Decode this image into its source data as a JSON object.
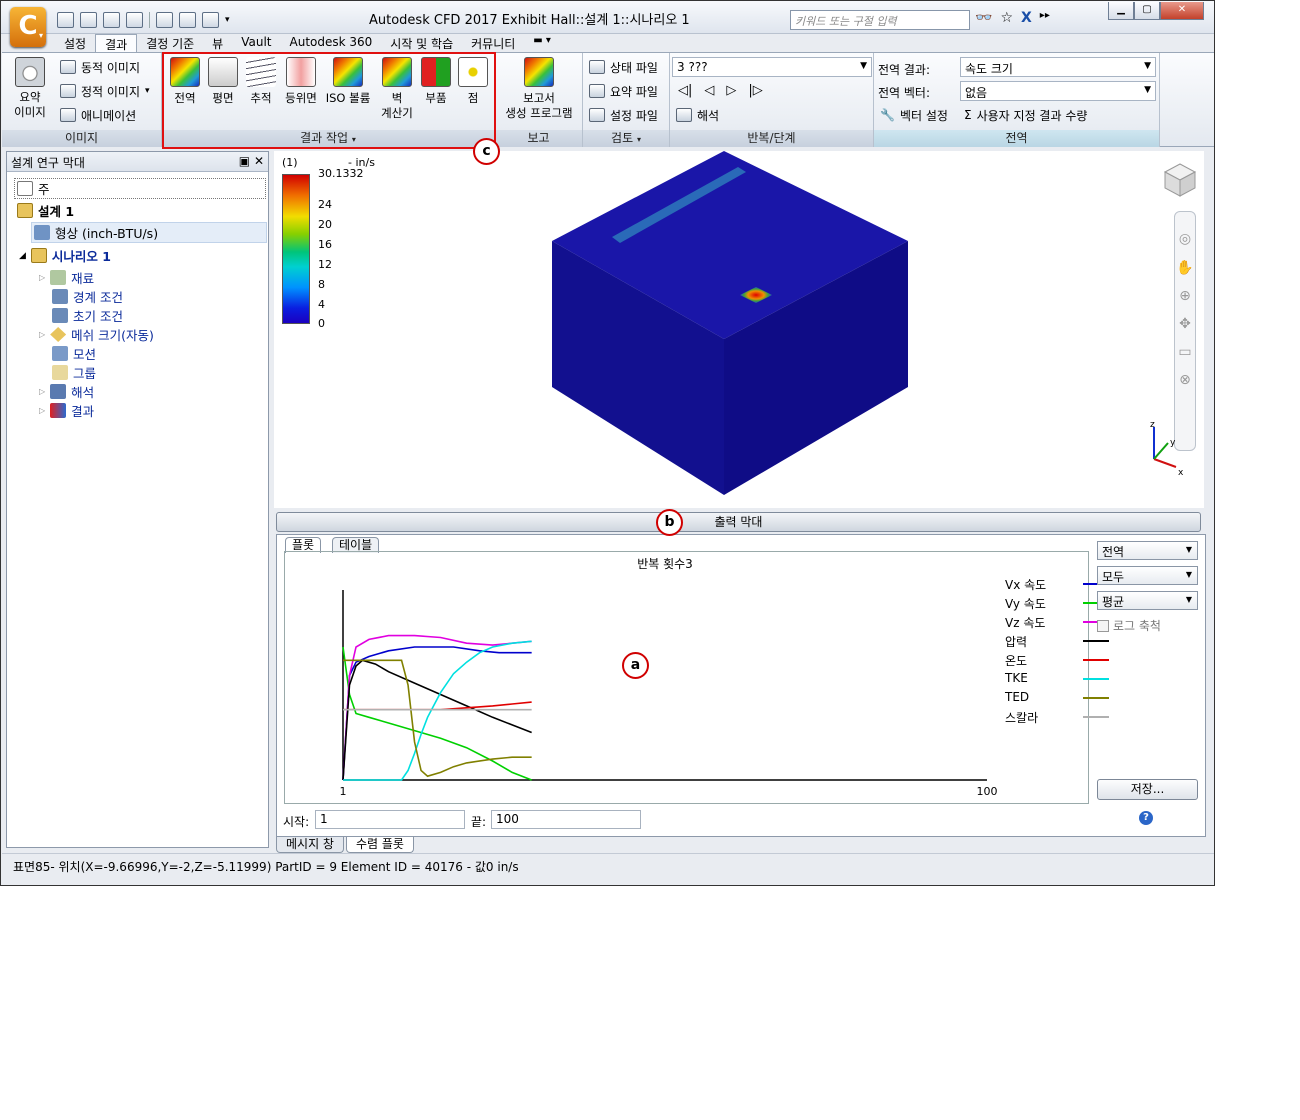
{
  "window": {
    "title": "Autodesk CFD 2017    Exhibit Hall::설계 1::시나리오 1",
    "search_placeholder": "키워드 또는 구절 입력",
    "app_letter": "C"
  },
  "menu_tabs": [
    "설정",
    "결과",
    "결정 기준",
    "뷰",
    "Vault",
    "Autodesk 360",
    "시작 및 학습",
    "커뮤니티"
  ],
  "ribbon": {
    "image_group": {
      "label": "이미지",
      "summary_image": "요약\n이미지",
      "summary_image_line1": "요약",
      "summary_image_line2": "이미지",
      "dynamic_image": "동적 이미지",
      "static_image": "정적 이미지",
      "animation": "애니메이션"
    },
    "results_group": {
      "label": "결과 작업",
      "buttons": [
        "전역",
        "평면",
        "추적",
        "등위면",
        "ISO 볼륨",
        "벽",
        "부품",
        "점"
      ],
      "wall_second_line": "계산기"
    },
    "report_group": {
      "label": "보고",
      "line1": "보고서",
      "line2": "생성 프로그램"
    },
    "review_group": {
      "label": "검토",
      "status_file": "상태 파일",
      "summary_file": "요약 파일",
      "setup_file": "설정 파일"
    },
    "iteration_group": {
      "label": "반복/단계",
      "selector": "3 ???",
      "analysis": "해석"
    },
    "global_group": {
      "label": "전역",
      "global_result_label": "전역 결과:",
      "global_result_value": "속도 크기",
      "global_vector_label": "전역 벡터:",
      "global_vector_value": "없음",
      "vector_settings": "벡터 설정",
      "custom_quantity": "사용자 지정 결과 수량"
    }
  },
  "callouts": {
    "a": "a",
    "b": "b",
    "c": "c"
  },
  "design_panel": {
    "title": "설계 연구 막대",
    "items": [
      {
        "label": "주"
      },
      {
        "label": "설계 1"
      },
      {
        "label": "형상 (inch-BTU/s)"
      },
      {
        "label": "시나리오 1"
      },
      {
        "label": "재료"
      },
      {
        "label": "경계 조건"
      },
      {
        "label": "초기 조건"
      },
      {
        "label": "메쉬 크기(자동)"
      },
      {
        "label": "모션"
      },
      {
        "label": "그룹"
      },
      {
        "label": "해석"
      },
      {
        "label": "결과"
      }
    ]
  },
  "viewport": {
    "legend_header": "(1)",
    "legend_unit": "- in/s",
    "legend_max": "30.1332",
    "legend_ticks": [
      "24",
      "20",
      "16",
      "12",
      "8",
      "4",
      "0"
    ],
    "axis_labels": {
      "z": "z",
      "y": "y",
      "x": "x"
    }
  },
  "output_bar": {
    "title": "출력 막대"
  },
  "output_tabs": {
    "plot": "플롯",
    "table": "테이블"
  },
  "chart_data": {
    "type": "line",
    "title": "반복 횟수3",
    "x_range": [
      1,
      100
    ],
    "tick_labels": [
      "1",
      "100"
    ],
    "x_plotted_until": 30,
    "series": [
      {
        "name": "Vx 속도",
        "color": "#0000cc",
        "values": [
          [
            1,
            0.0
          ],
          [
            2,
            0.55
          ],
          [
            3,
            0.62
          ],
          [
            5,
            0.65
          ],
          [
            8,
            0.68
          ],
          [
            12,
            0.7
          ],
          [
            18,
            0.7
          ],
          [
            22,
            0.68
          ],
          [
            25,
            0.67
          ],
          [
            30,
            0.67
          ]
        ]
      },
      {
        "name": "Vy 속도",
        "color": "#00d000",
        "values": [
          [
            1,
            0.7
          ],
          [
            2,
            0.45
          ],
          [
            3,
            0.35
          ],
          [
            5,
            0.33
          ],
          [
            8,
            0.3
          ],
          [
            12,
            0.26
          ],
          [
            16,
            0.22
          ],
          [
            20,
            0.17
          ],
          [
            24,
            0.1
          ],
          [
            27,
            0.04
          ],
          [
            30,
            0.0
          ]
        ]
      },
      {
        "name": "Vz 속도",
        "color": "#e000e0",
        "values": [
          [
            1,
            0.0
          ],
          [
            2,
            0.55
          ],
          [
            3,
            0.7
          ],
          [
            5,
            0.74
          ],
          [
            8,
            0.76
          ],
          [
            12,
            0.76
          ],
          [
            16,
            0.75
          ],
          [
            20,
            0.72
          ],
          [
            24,
            0.71
          ],
          [
            27,
            0.72
          ],
          [
            30,
            0.73
          ]
        ]
      },
      {
        "name": "압력",
        "color": "#000000",
        "values": [
          [
            1,
            0.0
          ],
          [
            2,
            0.5
          ],
          [
            3,
            0.6
          ],
          [
            4,
            0.63
          ],
          [
            6,
            0.61
          ],
          [
            8,
            0.57
          ],
          [
            12,
            0.51
          ],
          [
            16,
            0.45
          ],
          [
            20,
            0.39
          ],
          [
            24,
            0.33
          ],
          [
            27,
            0.29
          ],
          [
            30,
            0.25
          ]
        ]
      },
      {
        "name": "온도",
        "color": "#e00000",
        "values": [
          [
            1,
            0.37
          ],
          [
            10,
            0.37
          ],
          [
            16,
            0.37
          ],
          [
            20,
            0.38
          ],
          [
            24,
            0.39
          ],
          [
            27,
            0.4
          ],
          [
            30,
            0.41
          ]
        ]
      },
      {
        "name": "TKE",
        "color": "#00e0e0",
        "values": [
          [
            1,
            0.0
          ],
          [
            10,
            0.0
          ],
          [
            11,
            0.05
          ],
          [
            12,
            0.14
          ],
          [
            13,
            0.24
          ],
          [
            14,
            0.33
          ],
          [
            16,
            0.46
          ],
          [
            18,
            0.56
          ],
          [
            20,
            0.62
          ],
          [
            22,
            0.67
          ],
          [
            24,
            0.7
          ],
          [
            27,
            0.72
          ],
          [
            30,
            0.73
          ]
        ]
      },
      {
        "name": "TED",
        "color": "#808000",
        "values": [
          [
            1,
            0.63
          ],
          [
            10,
            0.63
          ],
          [
            11,
            0.5
          ],
          [
            12,
            0.2
          ],
          [
            13,
            0.05
          ],
          [
            14,
            0.02
          ],
          [
            16,
            0.04
          ],
          [
            18,
            0.07
          ],
          [
            20,
            0.09
          ],
          [
            24,
            0.11
          ],
          [
            27,
            0.12
          ],
          [
            30,
            0.12
          ]
        ]
      },
      {
        "name": "스칼라",
        "color": "#b0b0b0",
        "values": [
          [
            1,
            0.37
          ],
          [
            30,
            0.37
          ]
        ]
      }
    ]
  },
  "output_controls": {
    "scope": "전역",
    "filter": "모두",
    "stat": "평균",
    "log_scale": "로그 축척",
    "save": "저장...",
    "start_label": "시작:",
    "start_value": "1",
    "end_label": "끝:",
    "end_value": "100"
  },
  "bottom_tabs": [
    "메시지 창",
    "수렴 플롯"
  ],
  "status_bar": {
    "text": "표면85- 위치(X=-9.66996,Y=-2,Z=-5.11999) PartID = 9 Element ID = 40176 - 값0  in/s"
  }
}
